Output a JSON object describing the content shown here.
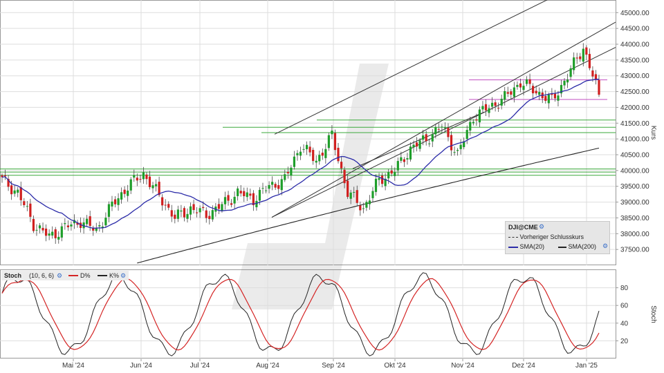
{
  "price_panel": {
    "y_axis_title": "Kurs",
    "y_ticks": [
      "45000.00",
      "44500.00",
      "44000.00",
      "43500.00",
      "43000.00",
      "42500.00",
      "42000.00",
      "41500.00",
      "41000.00",
      "40500.00",
      "40000.00",
      "39500.00",
      "39000.00",
      "38500.00",
      "38000.00",
      "37500.00"
    ]
  },
  "stoch_panel": {
    "y_axis_title": "Stoch",
    "y_ticks": [
      "80",
      "60",
      "40",
      "20"
    ],
    "header": {
      "name": "Stoch",
      "params": "(10, 6, 6)",
      "d_label": "D%",
      "k_label": "K%"
    }
  },
  "x_ticks": [
    "Mai '24",
    "Jun '24",
    "Jul '24",
    "Aug '24",
    "Sep '24",
    "Okt '24",
    "Nov '24",
    "Dez '24",
    "Jan '25"
  ],
  "legend": {
    "symbol": "DJI@CME",
    "prev_close": "Vorheriger Schlusskurs",
    "sma20": "SMA(20)",
    "sma200": "SMA(200)"
  },
  "colors": {
    "up": "#1e9e2a",
    "down": "#d01f1f",
    "sma20": "#2b2ba8",
    "sma200": "#222222",
    "stoch_k": "#222222",
    "stoch_d": "#d42424",
    "hline_green": "#3aa83a",
    "hline_magenta": "#c04cc0",
    "grid": "#dddddd"
  },
  "chart_data": [
    {
      "type": "candlestick",
      "y_range": [
        37000,
        45400
      ],
      "x_range": [
        "2024-04-15",
        "2025-01-10"
      ],
      "series": [
        {
          "name": "DJI@CME",
          "type": "candlestick",
          "approx_close": [
            [
              "2024-04-15",
              39700
            ],
            [
              "2024-04-22",
              39300
            ],
            [
              "2024-04-29",
              38300
            ],
            [
              "2024-05-06",
              37900
            ],
            [
              "2024-05-13",
              38200
            ],
            [
              "2024-05-20",
              38400
            ],
            [
              "2024-05-27",
              38100
            ],
            [
              "2024-06-03",
              38900
            ],
            [
              "2024-06-10",
              39500
            ],
            [
              "2024-06-17",
              39900
            ],
            [
              "2024-06-24",
              39200
            ],
            [
              "2024-07-01",
              38500
            ],
            [
              "2024-07-08",
              38800
            ],
            [
              "2024-07-15",
              38600
            ],
            [
              "2024-07-22",
              38900
            ],
            [
              "2024-07-29",
              39300
            ],
            [
              "2024-08-05",
              39100
            ],
            [
              "2024-08-12",
              39500
            ],
            [
              "2024-08-19",
              39700
            ],
            [
              "2024-08-26",
              40800
            ],
            [
              "2024-09-02",
              40300
            ],
            [
              "2024-09-09",
              41100
            ],
            [
              "2024-09-16",
              39300
            ],
            [
              "2024-09-23",
              38800
            ],
            [
              "2024-09-30",
              39700
            ],
            [
              "2024-10-07",
              40000
            ],
            [
              "2024-10-14",
              40700
            ],
            [
              "2024-10-21",
              41000
            ],
            [
              "2024-10-28",
              41400
            ],
            [
              "2024-11-04",
              40500
            ],
            [
              "2024-11-11",
              41700
            ],
            [
              "2024-11-18",
              42000
            ],
            [
              "2024-11-25",
              42300
            ],
            [
              "2024-12-02",
              42800
            ],
            [
              "2024-12-09",
              42500
            ],
            [
              "2024-12-16",
              42200
            ],
            [
              "2024-12-23",
              43000
            ],
            [
              "2024-12-30",
              43900
            ],
            [
              "2025-01-06",
              42400
            ]
          ]
        },
        {
          "name": "SMA(20)",
          "type": "line",
          "color": "#2b2ba8"
        },
        {
          "name": "SMA(200)",
          "type": "line",
          "color": "#222222"
        }
      ],
      "horizontal_levels": [
        45070,
        42870,
        42250,
        41600,
        41370,
        41200,
        40050,
        39950,
        39850
      ]
    },
    {
      "type": "line",
      "title": "Stoch (10, 6, 6)",
      "y_range": [
        0,
        100
      ],
      "series": [
        {
          "name": "D%",
          "color": "#d42424"
        },
        {
          "name": "K%",
          "color": "#222222"
        }
      ]
    }
  ]
}
